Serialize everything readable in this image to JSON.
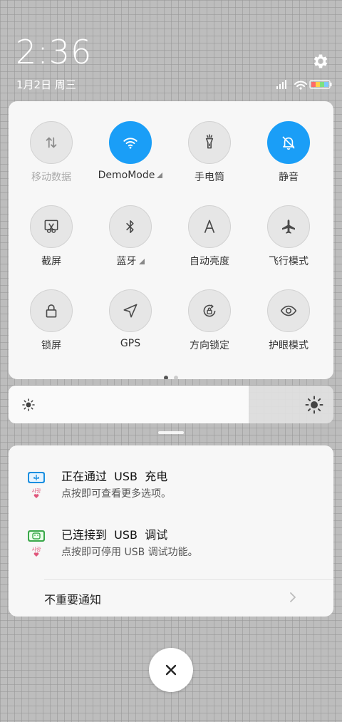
{
  "header": {
    "time": "2:36",
    "date": "1月2日 周三"
  },
  "quick_settings": {
    "tiles": [
      {
        "id": "mobile-data",
        "label": "移动数据",
        "icon": "data-arrows-icon",
        "active": false,
        "dimmed": true,
        "dropdown": false
      },
      {
        "id": "wifi",
        "label": "DemoMode",
        "icon": "wifi-icon",
        "active": true,
        "dimmed": false,
        "dropdown": true
      },
      {
        "id": "flashlight",
        "label": "手电筒",
        "icon": "flashlight-icon",
        "active": false,
        "dimmed": false,
        "dropdown": false
      },
      {
        "id": "mute",
        "label": "静音",
        "icon": "bell-off-icon",
        "active": true,
        "dimmed": false,
        "dropdown": false
      },
      {
        "id": "screenshot",
        "label": "截屏",
        "icon": "scissors-icon",
        "active": false,
        "dimmed": false,
        "dropdown": false
      },
      {
        "id": "bluetooth",
        "label": "蓝牙",
        "icon": "bluetooth-icon",
        "active": false,
        "dimmed": false,
        "dropdown": true
      },
      {
        "id": "auto-brightness",
        "label": "自动亮度",
        "icon": "letter-a-icon",
        "active": false,
        "dimmed": false,
        "dropdown": false
      },
      {
        "id": "airplane",
        "label": "飞行模式",
        "icon": "airplane-icon",
        "active": false,
        "dimmed": false,
        "dropdown": false
      },
      {
        "id": "lock-screen",
        "label": "锁屏",
        "icon": "lock-icon",
        "active": false,
        "dimmed": false,
        "dropdown": false
      },
      {
        "id": "gps",
        "label": "GPS",
        "icon": "location-arrow-icon",
        "active": false,
        "dimmed": false,
        "dropdown": false
      },
      {
        "id": "rotation-lock",
        "label": "方向锁定",
        "icon": "rotation-lock-icon",
        "active": false,
        "dimmed": false,
        "dropdown": false
      },
      {
        "id": "eye-care",
        "label": "护眼模式",
        "icon": "eye-icon",
        "active": false,
        "dimmed": false,
        "dropdown": false
      }
    ],
    "page_count": 2,
    "current_page": 1,
    "accent_color": "#1a9ef7"
  },
  "brightness": {
    "level": 0.74
  },
  "notifications": [
    {
      "title": "正在通过  USB  充电",
      "text": "点按即可查看更多选项。",
      "icon": "usb-charge-icon"
    },
    {
      "title": "已连接到  USB  调试",
      "text": "点按即可停用 USB 调试功能。",
      "icon": "android-debug-icon"
    }
  ],
  "unimportant": {
    "label": "不重要通知"
  },
  "close": {
    "icon": "close-icon"
  }
}
